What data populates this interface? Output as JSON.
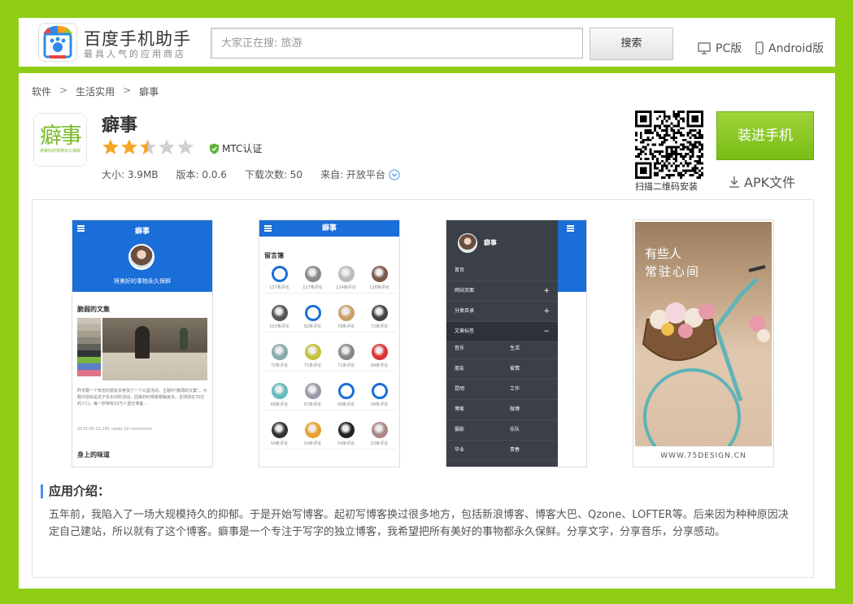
{
  "header": {
    "logo_title": "百度手机助手",
    "logo_subtitle": "最具人气的应用商店",
    "search_placeholder": "大家正在搜: 旅游",
    "search_button": "搜索",
    "pc_link": "PC版",
    "android_link": "Android版"
  },
  "breadcrumb": [
    "软件",
    "生活实用",
    "癖事"
  ],
  "app": {
    "name": "癖事",
    "rating_stars": 2.5,
    "rating_max": 5,
    "mtc_label": "MTC认证",
    "icon_text": "癖事",
    "icon_tagline": "将美好的事物永久保鲜",
    "size": "大小: 3.9MB",
    "version": "版本: 0.0.6",
    "downloads": "下载次数: 50",
    "source": "来自: 开放平台"
  },
  "actions": {
    "qr_label": "扫描二维码安装",
    "install_button": "装进手机",
    "apk_link": "APK文件"
  },
  "screenshots": {
    "shot1": {
      "title": "癖事",
      "slogan": "将美好的事物永久保鲜",
      "post_title": "脆弱的文集",
      "post_body": "昨天跟一个朱忠的朋友去参加了一个公益活动，主题叫\"脆弱的文集\"。大概内容就是关于东东你的活动，回来的时候顿顿触良多，全球现在70亿的人口，每一秒钟有10万人登记准备...",
      "post_meta": "2015-06-22   291 views   10 comments",
      "post2_title": "身上的味道"
    },
    "shot2": {
      "title": "癖事",
      "section": "留言簿",
      "counts": [
        "137条评论",
        "127条评论",
        "124条评论",
        "116条评论",
        "102条评论",
        "92条评论",
        "79条评论",
        "72条评论",
        "72条评论",
        "71条评论",
        "71条评论",
        "69条评论",
        "68条评论",
        "67条评论",
        "58条评论",
        "58条评论",
        "54条评论",
        "54条评论",
        "54条评论",
        "53条评论"
      ]
    },
    "shot3": {
      "title": "癖事",
      "menu": [
        "首页",
        "网站页面",
        "分类目录",
        "文章标签"
      ],
      "tags": [
        [
          "音乐",
          "生活"
        ],
        [
          "朋友",
          "爱情"
        ],
        [
          "昆明",
          "工作"
        ],
        [
          "博客",
          "微博"
        ],
        [
          "摄影",
          "乐队"
        ],
        [
          "毕业",
          "青春"
        ],
        [
          "广告",
          "游戏"
        ]
      ]
    },
    "shot4": {
      "text_line1": "有些人",
      "text_line2": "常驻心间",
      "footer": "WWW.75DESIGN.CN"
    }
  },
  "intro": {
    "title": "应用介绍：",
    "text": "五年前，我陷入了一场大规模持久的抑郁。于是开始写博客。起初写博客换过很多地方，包括新浪博客、博客大巴、Qzone、LOFTER等。后来因为种种原因决定自己建站，所以就有了这个博客。癖事是一个专注于写字的独立博客，我希望把所有美好的事物都永久保鲜。分享文字，分享音乐，分享感动。"
  },
  "colors": {
    "page_background": "#8fce14",
    "install_button": "#86c51f",
    "mini_app_bar": "#1a6ed8",
    "star_filled": "#f5a623",
    "star_empty": "#d0d0d0"
  }
}
